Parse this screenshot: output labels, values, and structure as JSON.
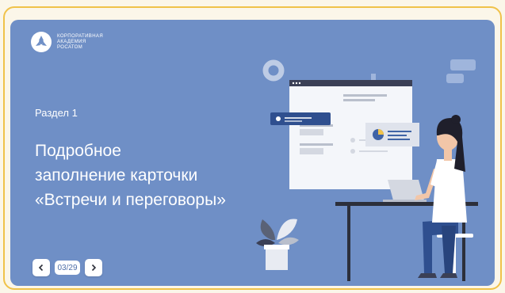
{
  "colors": {
    "slide_bg": "#6f8fc6",
    "frame_border": "#f0c24a",
    "accent_blue": "#3f63a6",
    "text": "#ffffff"
  },
  "logo": {
    "line1": "КОРПОРАТИВНАЯ",
    "line2": "АКАДЕМИЯ",
    "line3": "РОСАТОМ",
    "icon": "rosatom-logo-icon"
  },
  "slide": {
    "section": "Раздел 1",
    "title_lines": [
      "Подробное",
      "заполнение карточки",
      "«Встречи и переговоры»"
    ]
  },
  "navigation": {
    "prev_icon": "chevron-left-icon",
    "next_icon": "chevron-right-icon",
    "page": "03/29"
  }
}
